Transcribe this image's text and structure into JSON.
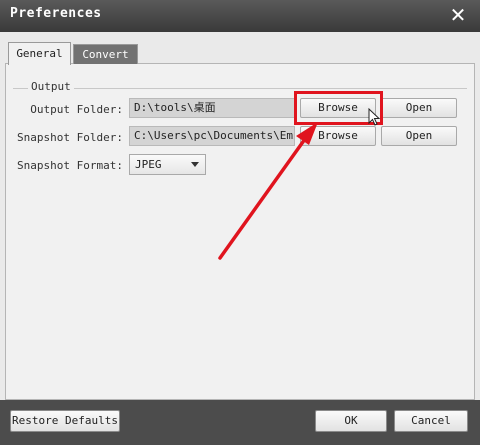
{
  "window": {
    "title": "Preferences",
    "close_glyph": "✕"
  },
  "tabs": [
    {
      "label": "General",
      "active": true
    },
    {
      "label": "Convert",
      "active": false
    }
  ],
  "output_group": {
    "title": "Output"
  },
  "output_folder": {
    "label": "Output Folder:",
    "value": "D:\\tools\\桌面",
    "browse": "Browse",
    "open": "Open"
  },
  "snapshot_folder": {
    "label": "Snapshot Folder:",
    "value": "C:\\Users\\pc\\Documents\\Emic",
    "browse": "Browse",
    "open": "Open"
  },
  "snapshot_format": {
    "label": "Snapshot Format:",
    "value": "JPEG"
  },
  "footer": {
    "restore": "Restore Defaults",
    "ok": "OK",
    "cancel": "Cancel"
  },
  "colors": {
    "highlight": "#e0141e",
    "titlebar": "#3a3a3a",
    "footer": "#4c4c4c"
  }
}
